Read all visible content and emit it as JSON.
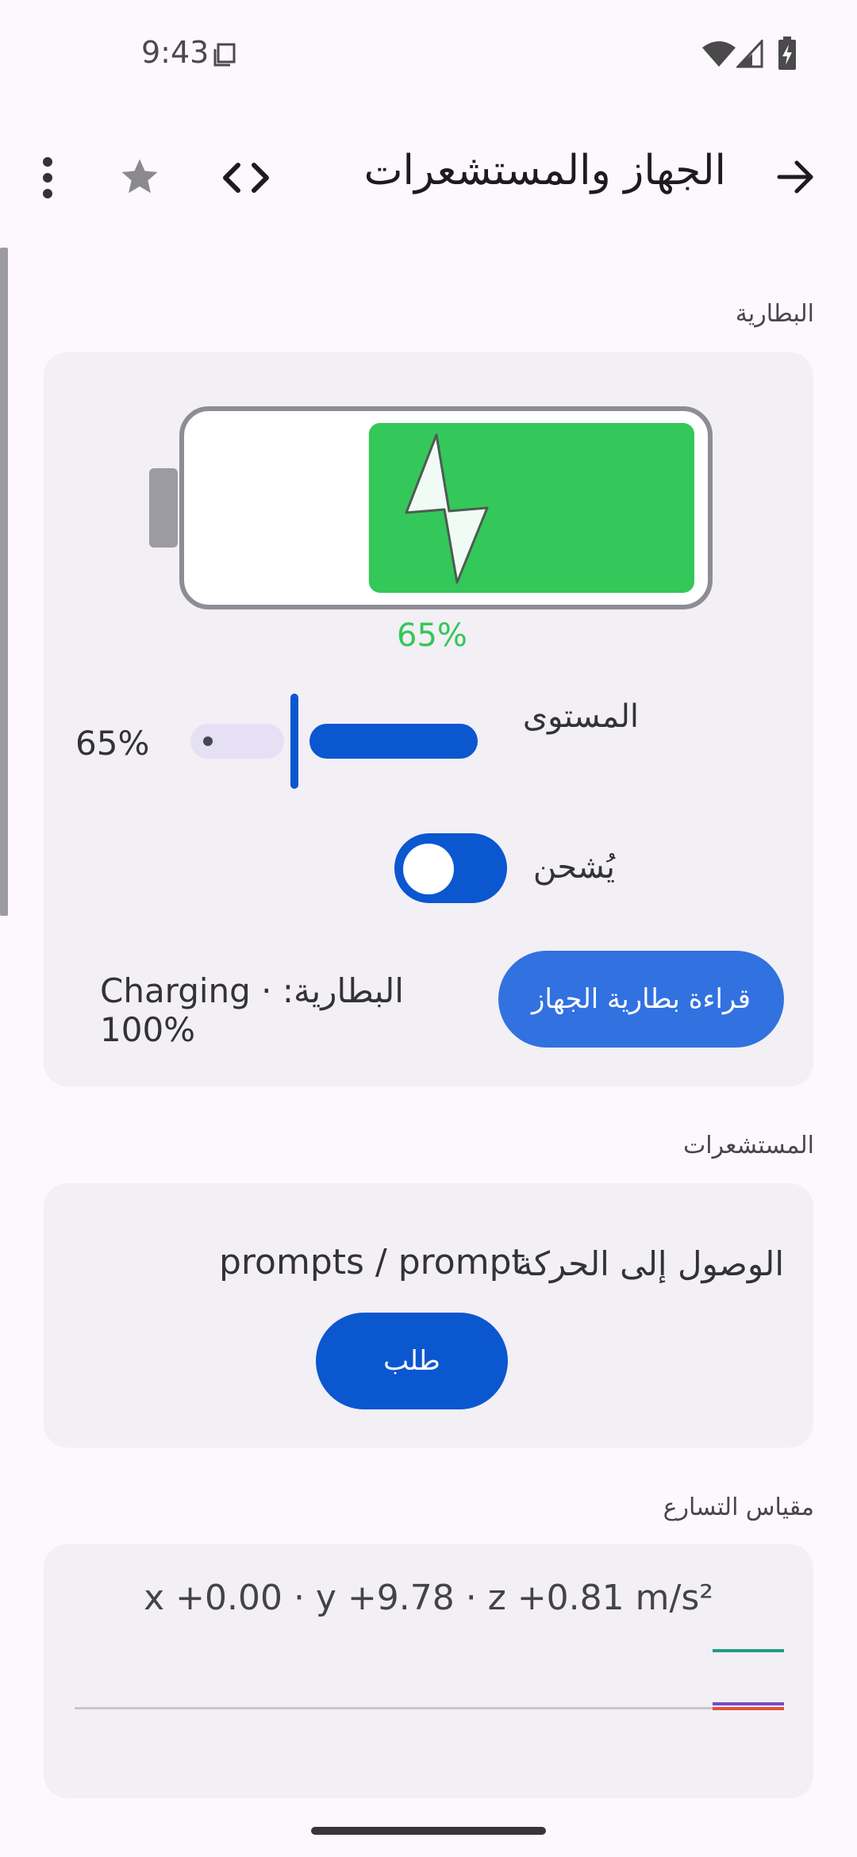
{
  "status_bar": {
    "time": "9:43",
    "icons": [
      "sim-card-icon",
      "wifi-icon",
      "cellular-icon",
      "battery-charging-icon"
    ]
  },
  "app_bar": {
    "title": "الجهاز والمستشعرات",
    "icons": [
      "back-arrow-icon",
      "code-icon",
      "star-icon",
      "more-vert-icon"
    ]
  },
  "battery_section": {
    "label": "البطارية",
    "level_percent_label": "65%",
    "level_fraction": 0.65,
    "level_label": "المستوى",
    "level_value": "65%",
    "charging_label": "يُشحن",
    "charging_on": true,
    "read_button": "قراءة بطارية الجهاز",
    "status_text": "البطارية: Charging · 100%"
  },
  "sensors_section": {
    "label": "المستشعرات",
    "motion_access_label": "الوصول إلى الحركة",
    "motion_status": "prompts / prompt",
    "request_button": "طلب"
  },
  "accelerometer_section": {
    "label": "مقياس التسارع",
    "readout": "x +0.00 · y +9.78 · z +0.81 m/s²"
  },
  "colors": {
    "accent": "#0b57d0",
    "battery_green": "#34c759",
    "accel_x": "#1f9c86",
    "accel_y": "#7b4bc4",
    "accel_z": "#e0523a"
  }
}
